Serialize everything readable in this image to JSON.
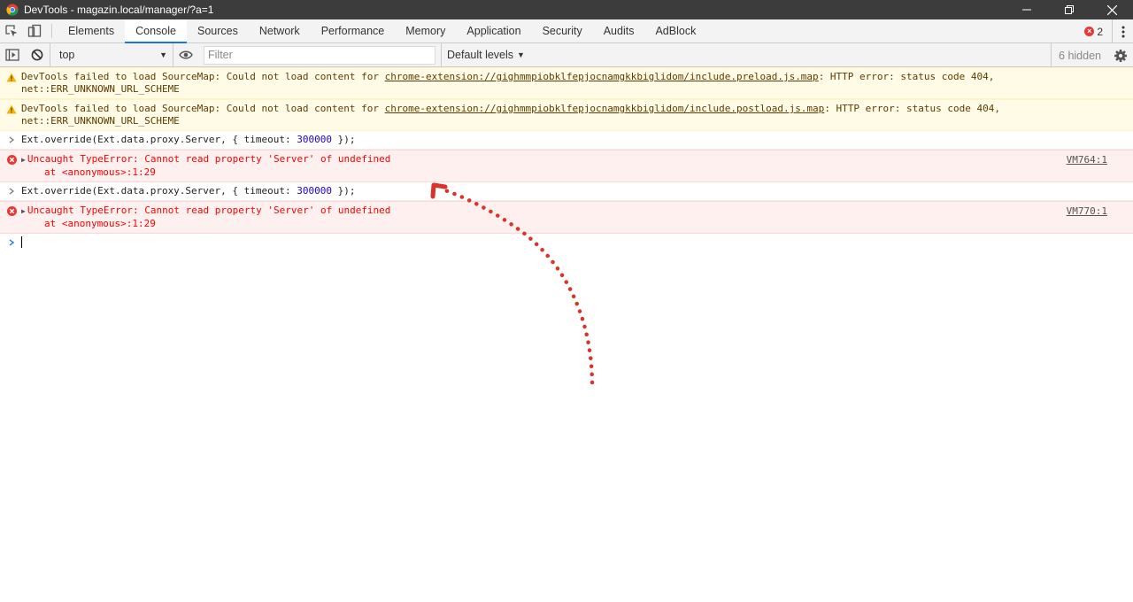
{
  "window": {
    "title": "DevTools - magazin.local/manager/?a=1"
  },
  "tabs": [
    {
      "label": "Elements"
    },
    {
      "label": "Console",
      "active": true
    },
    {
      "label": "Sources"
    },
    {
      "label": "Network"
    },
    {
      "label": "Performance"
    },
    {
      "label": "Memory"
    },
    {
      "label": "Application"
    },
    {
      "label": "Security"
    },
    {
      "label": "Audits"
    },
    {
      "label": "AdBlock"
    }
  ],
  "error_badge": {
    "count": "2"
  },
  "toolbar": {
    "context": "top",
    "filter_placeholder": "Filter",
    "filter_value": "",
    "levels": "Default levels",
    "hidden": "6 hidden"
  },
  "messages": {
    "warn1": {
      "prefix": "DevTools failed to load SourceMap: Could not load content for ",
      "link": "chrome-extension://gighmmpiobklfepjocnamgkkbiglidom/include.preload.js.map",
      "suffix": ": HTTP error: status code 404,",
      "line2": "net::ERR_UNKNOWN_URL_SCHEME"
    },
    "warn2": {
      "prefix": "DevTools failed to load SourceMap: Could not load content for ",
      "link": "chrome-extension://gighmmpiobklfepjocnamgkkbiglidom/include.postload.js.map",
      "suffix": ": HTTP error: status code 404,",
      "line2": "net::ERR_UNKNOWN_URL_SCHEME"
    },
    "cmd1": {
      "before": "Ext.override(Ext.data.proxy.Server, { timeout: ",
      "number": "300000",
      "after": " });"
    },
    "err1": {
      "text": "Uncaught TypeError: Cannot read property 'Server' of undefined",
      "line2": "at <anonymous>:1:29",
      "source": "VM764:1"
    },
    "cmd2": {
      "before": "Ext.override(Ext.data.proxy.Server, { timeout: ",
      "number": "300000",
      "after": " });"
    },
    "err2": {
      "text": "Uncaught TypeError: Cannot read property 'Server' of undefined",
      "line2": "at <anonymous>:1:29",
      "source": "VM770:1"
    }
  },
  "colors": {
    "annotation_arrow": "#d9342b",
    "tab_underline": "#1a73e8"
  }
}
